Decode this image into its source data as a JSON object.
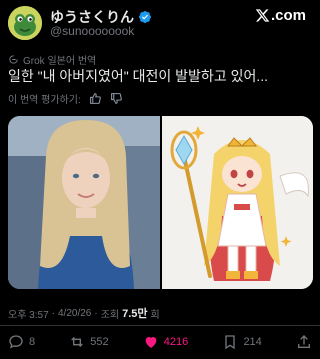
{
  "author": {
    "name": "ゆうさくりん",
    "handle": "@sunoooooook",
    "verified": true
  },
  "brand": {
    "logo_text": ".com",
    "logo_icon": "x-logo-icon"
  },
  "translation": {
    "notice": "Grok 일본어 번역",
    "rate_prompt": "이 번역 평가하기:"
  },
  "tweet": {
    "text": "일한 \"내 아버지였어\" 대전이 발발하고 있어..."
  },
  "media": {
    "count": 2,
    "left": {
      "kind": "photo",
      "icon": "photo-girl"
    },
    "right": {
      "kind": "illustration",
      "icon": "anime-girl-staff"
    }
  },
  "meta": {
    "time": "오후 3:57",
    "date": "4/20/26",
    "sep": "·",
    "views_label": "조회",
    "views_count": "7.5만",
    "views_suffix": "회"
  },
  "actions": {
    "replies": "8",
    "reposts": "552",
    "likes": "4216",
    "bookmarks": "214"
  },
  "colors": {
    "background": "#000000",
    "text": "#e7e9ea",
    "muted": "#71767b",
    "like": "#f91880",
    "verified": "#1d9bf0",
    "divider": "#2f3336"
  }
}
